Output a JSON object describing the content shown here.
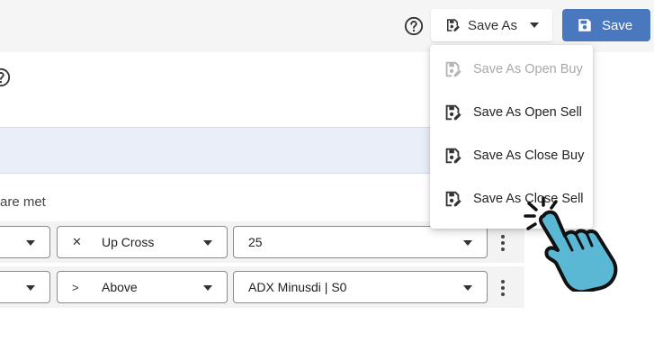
{
  "toolbar": {
    "save_as_label": "Save As",
    "save_label": "Save"
  },
  "section": {
    "conditions_text": "are met"
  },
  "rows": [
    {
      "operator_symbol": "✕",
      "operator_label": "Up Cross",
      "value": "25"
    },
    {
      "operator_symbol": ">",
      "operator_label": "Above",
      "value": "ADX Minusdi | S0"
    }
  ],
  "save_as_menu": {
    "items": [
      {
        "label": "Save As Open Buy",
        "disabled": true
      },
      {
        "label": "Save As Open Sell",
        "disabled": false
      },
      {
        "label": "Save As Close Buy",
        "disabled": false
      },
      {
        "label": "Save As Close Sell",
        "disabled": false
      }
    ]
  },
  "colors": {
    "primary": "#4a78bf",
    "band": "#e9eef8",
    "hand_fill": "#5bb8d4"
  }
}
